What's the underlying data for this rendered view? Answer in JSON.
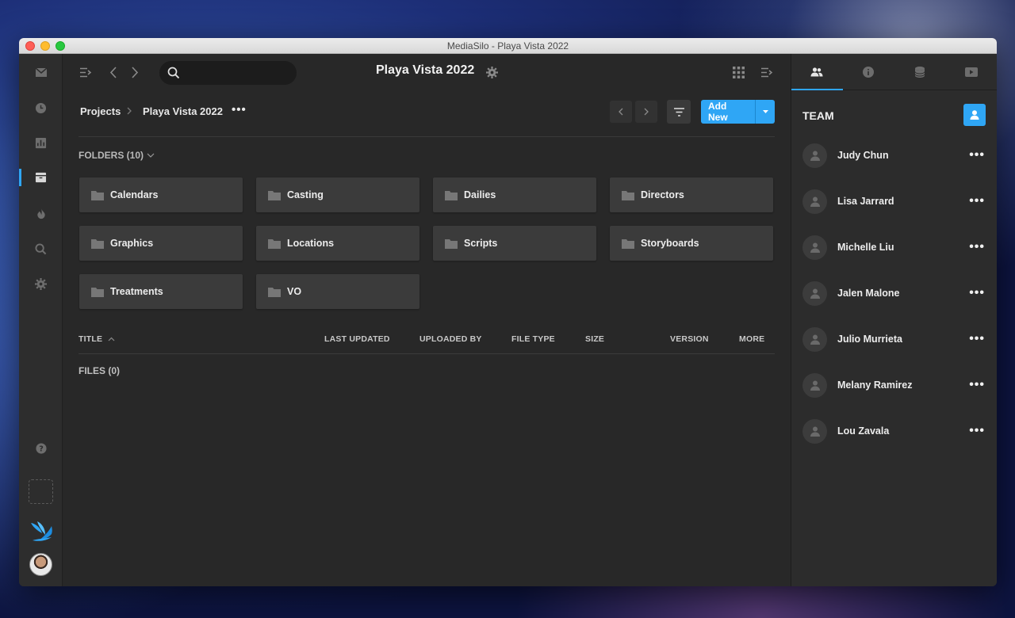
{
  "window": {
    "title": "MediaSilo - Playa Vista 2022"
  },
  "topbar": {
    "page_title": "Playa Vista 2022",
    "search_placeholder": ""
  },
  "breadcrumb": {
    "root": "Projects",
    "current": "Playa Vista 2022",
    "more": "•••"
  },
  "actions": {
    "add_new": "Add New"
  },
  "folders": {
    "header": "FOLDERS (10)",
    "items": [
      "Calendars",
      "Casting",
      "Dailies",
      "Directors",
      "Graphics",
      "Locations",
      "Scripts",
      "Storyboards",
      "Treatments",
      "VO"
    ]
  },
  "table": {
    "columns": [
      "TITLE",
      "LAST UPDATED",
      "UPLOADED BY",
      "FILE TYPE",
      "SIZE",
      "VERSION",
      "MORE"
    ]
  },
  "files": {
    "label": "FILES (0)"
  },
  "team": {
    "title": "TEAM",
    "more": "•••",
    "members": [
      "Judy Chun",
      "Lisa Jarrard",
      "Michelle Liu",
      "Jalen Malone",
      "Julio Murrieta",
      "Melany Ramirez",
      "Lou Zavala"
    ]
  },
  "colors": {
    "accent": "#2fa6f5",
    "background": "#282828",
    "tile": "#3b3b3b"
  }
}
